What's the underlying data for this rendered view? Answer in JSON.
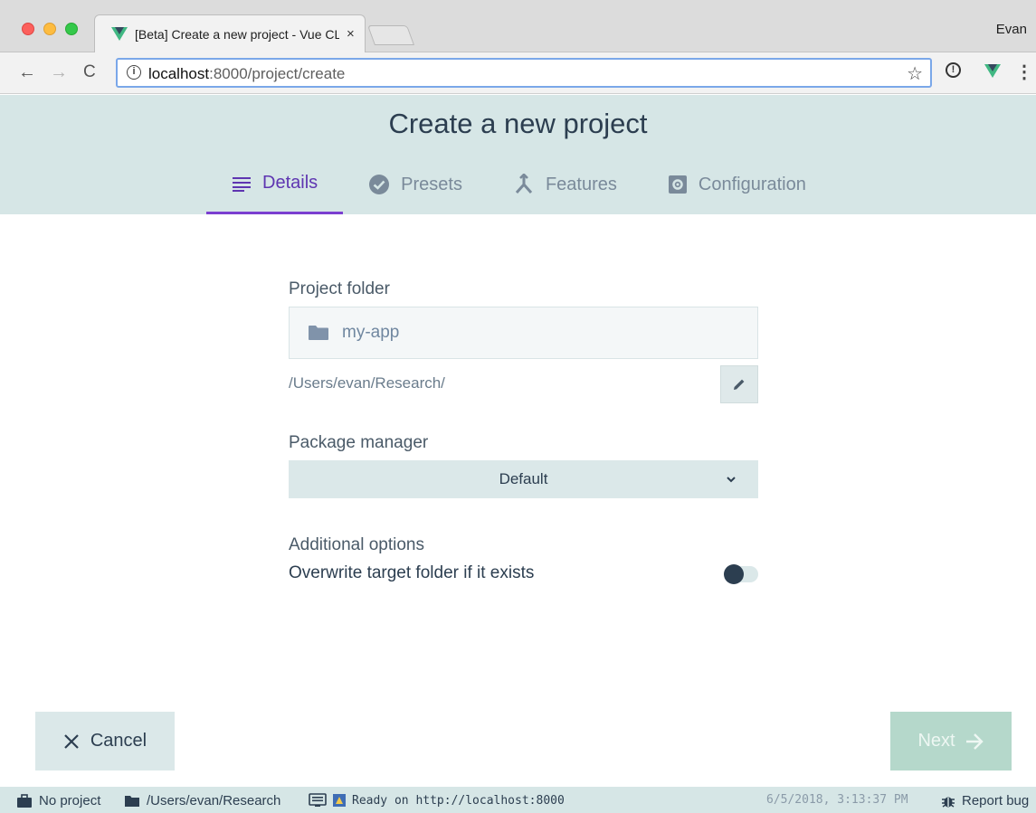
{
  "browser": {
    "tab_title": "[Beta] Create a new project - Vue CLI",
    "tab_close": "×",
    "profile_name": "Evan",
    "url_host": "localhost",
    "url_rest": ":8000/project/create",
    "nav": {
      "back": "←",
      "forward": "→",
      "reload": "C"
    },
    "star": "☆",
    "ext_icon": "!",
    "menu": "⋮"
  },
  "header": {
    "title": "Create a new project",
    "steps": [
      {
        "label": "Details",
        "icon": "list-icon",
        "active": true
      },
      {
        "label": "Presets",
        "icon": "check-circle-icon",
        "active": false
      },
      {
        "label": "Features",
        "icon": "merge-icon",
        "active": false
      },
      {
        "label": "Configuration",
        "icon": "settings-box-icon",
        "active": false
      }
    ]
  },
  "form": {
    "project_folder_label": "Project folder",
    "project_folder_value": "my-app",
    "path": "/Users/evan/Research/",
    "package_manager_label": "Package manager",
    "package_manager_value": "Default",
    "chevron": "⌄",
    "additional_options_label": "Additional options",
    "overwrite_label": "Overwrite target folder if it exists",
    "overwrite_enabled": false
  },
  "actions": {
    "cancel": "Cancel",
    "next": "Next"
  },
  "statusbar": {
    "project": "No project",
    "folder": "/Users/evan/Research",
    "status": "Ready on http://localhost:8000",
    "timestamp": "6/5/2018, 3:13:37 PM",
    "report_bug": "Report bug"
  },
  "colors": {
    "accent": "#5e35b1",
    "header_bg": "#d6e6e6",
    "next_disabled": "#b5d8cb"
  }
}
